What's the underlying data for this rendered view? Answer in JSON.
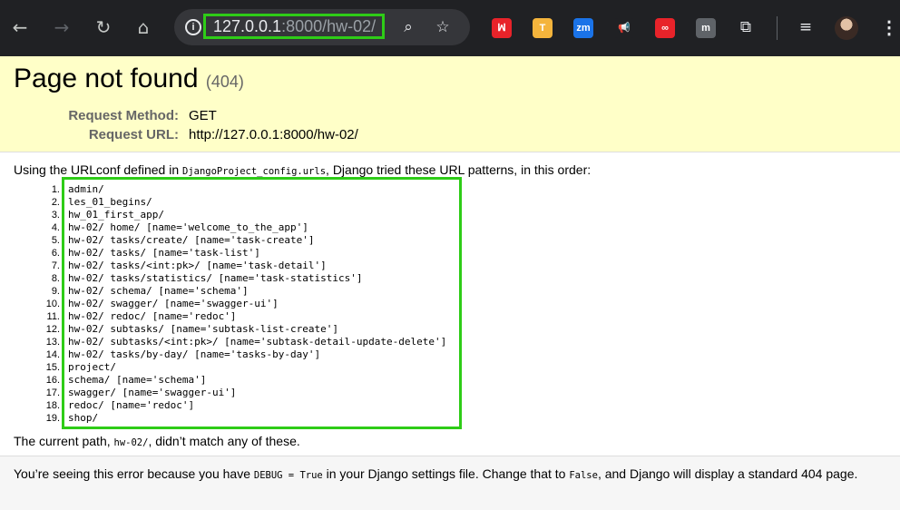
{
  "browser": {
    "url_host": "127.0.0.1",
    "url_path": ":8000/hw-02/",
    "nav_icons": [
      "back-arrow-icon",
      "forward-arrow-icon",
      "reload-icon",
      "home-icon"
    ],
    "extensions": [
      {
        "name": "extension-red-m-icon",
        "label": "ꟽ",
        "color": "#e8232a"
      },
      {
        "name": "extension-t-icon",
        "label": "T",
        "color": "#f4b43c"
      },
      {
        "name": "extension-zm-icon",
        "label": "zm",
        "color": "#1a73e8"
      },
      {
        "name": "extension-megaphone-icon",
        "label": "📢",
        "color": "#202124"
      },
      {
        "name": "extension-infinity-icon",
        "label": "∞",
        "color": "#e8232a"
      },
      {
        "name": "extension-m-icon",
        "label": "m",
        "color": "#5f6368"
      }
    ]
  },
  "page": {
    "title": "Page not found",
    "status_code": "(404)",
    "request_method_label": "Request Method:",
    "request_method": "GET",
    "request_url_label": "Request URL:",
    "request_url": "http://127.0.0.1:8000/hw-02/",
    "info_prefix": "Using the URLconf defined in ",
    "urlconf": "DjangoProject_config.urls",
    "info_suffix": ", Django tried these URL patterns, in this order:",
    "patterns": [
      "admin/",
      "les_01_begins/",
      "hw_01_first_app/",
      "hw-02/ home/ [name='welcome_to_the_app']",
      "hw-02/ tasks/create/ [name='task-create']",
      "hw-02/ tasks/ [name='task-list']",
      "hw-02/ tasks/<int:pk>/ [name='task-detail']",
      "hw-02/ tasks/statistics/ [name='task-statistics']",
      "hw-02/ schema/ [name='schema']",
      "hw-02/ swagger/ [name='swagger-ui']",
      "hw-02/ redoc/ [name='redoc']",
      "hw-02/ subtasks/ [name='subtask-list-create']",
      "hw-02/ subtasks/<int:pk>/ [name='subtask-detail-update-delete']",
      "hw-02/ tasks/by-day/ [name='tasks-by-day']",
      "project/",
      "schema/ [name='schema']",
      "swagger/ [name='swagger-ui']",
      "redoc/ [name='redoc']",
      "shop/"
    ],
    "current_prefix": "The current path, ",
    "current_path": "hw-02/",
    "current_suffix": ", didn’t match any of these.",
    "explanation_1": "You’re seeing this error because you have ",
    "debug_code": "DEBUG = True",
    "explanation_2": " in your Django settings file. Change that to ",
    "false_code": "False",
    "explanation_3": ", and Django will display a standard 404 page."
  },
  "colors": {
    "highlight": "#2ecc17",
    "summary_bg": "#ffffc8",
    "chrome_bg": "#202124"
  }
}
